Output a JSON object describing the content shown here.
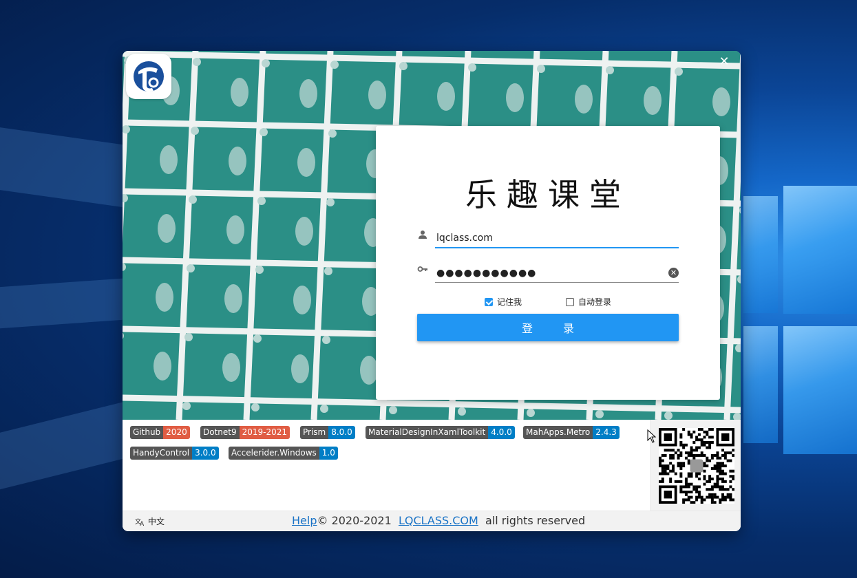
{
  "window": {
    "close_icon": "close-icon",
    "close_glyph": "✕"
  },
  "login": {
    "title": "乐趣课堂",
    "username_value": "lqclass.com",
    "password_mask": "●●●●●●●●●●●",
    "remember_label": "记住我",
    "remember_checked": true,
    "auto_login_label": "自动登录",
    "auto_login_checked": false,
    "login_button": "登录"
  },
  "badges": [
    {
      "name": "Github",
      "value": "2020",
      "color": "#e05d44"
    },
    {
      "name": "Dotnet9",
      "value": "2019-2021",
      "color": "#e05d44"
    },
    {
      "name": "Prism",
      "value": "8.0.0",
      "color": "#007ec6"
    },
    {
      "name": "MaterialDesignInXamlToolkit",
      "value": "4.0.0",
      "color": "#007ec6"
    },
    {
      "name": "MahApps.Metro",
      "value": "2.4.3",
      "color": "#007ec6"
    },
    {
      "name": "HandyControl",
      "value": "3.0.0",
      "color": "#007ec6"
    },
    {
      "name": "Accelerider.Windows",
      "value": "1.0",
      "color": "#007ec6"
    }
  ],
  "footer": {
    "language": "中文",
    "help_link": "Help",
    "copyright": "© 2020-2021",
    "site_link": "LQCLASS.COM",
    "rights": "all rights reserved"
  },
  "colors": {
    "accent": "#2196f3",
    "hero": "#2a8f86"
  }
}
